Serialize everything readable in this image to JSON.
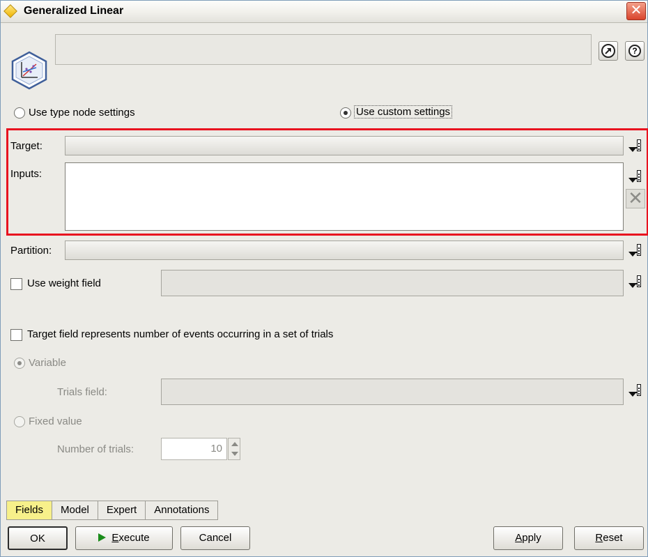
{
  "window": {
    "title": "Generalized Linear",
    "close_glyph": "✕"
  },
  "header": {
    "node_icon": "generalized-linear-node-icon",
    "name_value": "",
    "launch_icon": "arrow-up-right-icon",
    "help_glyph": "?"
  },
  "settings": {
    "type_node_label": "Use type node settings",
    "custom_label": "Use custom settings",
    "selected": "custom"
  },
  "fields": {
    "target_label": "Target:",
    "target_value": "",
    "inputs_label": "Inputs:",
    "inputs_items": [],
    "remove_glyph": "✕",
    "partition_label": "Partition:",
    "partition_value": "",
    "weight_label": "Use weight field",
    "weight_checked": false,
    "weight_value": ""
  },
  "trials": {
    "events_label": "Target field represents number of events occurring in a set of trials",
    "events_checked": false,
    "variable_label": "Variable",
    "trials_field_label": "Trials field:",
    "trials_field_value": "",
    "fixed_label": "Fixed value",
    "number_label": "Number of trials:",
    "number_value": "10"
  },
  "tabs": [
    {
      "label": "Fields",
      "active": true
    },
    {
      "label": "Model",
      "active": false
    },
    {
      "label": "Expert",
      "active": false
    },
    {
      "label": "Annotations",
      "active": false
    }
  ],
  "buttons": {
    "ok": "OK",
    "execute_first": "E",
    "execute_rest": "xecute",
    "cancel": "Cancel",
    "apply_first": "A",
    "apply_rest": "pply",
    "reset_first": "R",
    "reset_rest": "eset"
  },
  "colors": {
    "highlight": "#e8121f",
    "active_tab": "#f7f08a",
    "execute_icon": "#1a8c1a"
  }
}
